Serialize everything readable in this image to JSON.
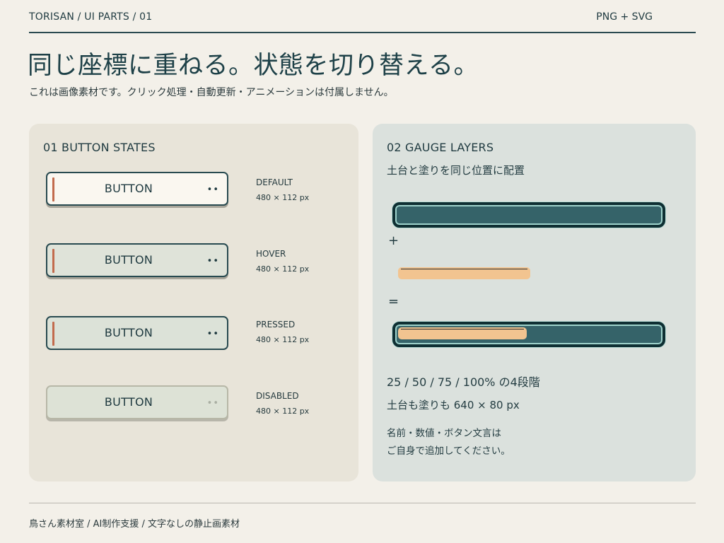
{
  "header": {
    "brand": "TORISAN / UI PARTS / 01",
    "format": "PNG + SVG"
  },
  "title": "同じ座標に重ねる。状態を切り替える。",
  "subtitle": "これは画像素材です。クリック処理・自動更新・アニメーションは付属しません。",
  "button_panel": {
    "heading": "01  BUTTON STATES",
    "buttons": [
      {
        "label": "BUTTON",
        "dots": "••",
        "state": "DEFAULT",
        "size": "480 × 112 px"
      },
      {
        "label": "BUTTON",
        "dots": "••",
        "state": "HOVER",
        "size": "480 × 112 px"
      },
      {
        "label": "BUTTON",
        "dots": "••",
        "state": "PRESSED",
        "size": "480 × 112 px"
      },
      {
        "label": "BUTTON",
        "dots": "••",
        "state": "DISABLED",
        "size": "480 × 112 px"
      }
    ]
  },
  "gauge_panel": {
    "heading": "02  GAUGE LAYERS",
    "subheading": "土台と塗りを同じ位置に配置",
    "plus": "+",
    "equals": "=",
    "fill_level": 0.5,
    "steps_note": "25 / 50 / 75 / 100% の4段階",
    "size_note": "土台も塗りも 640 × 80 px",
    "note_line1": "名前・数値・ボタン文言は",
    "note_line2": "ご自身で追加してください。"
  },
  "footer": "鳥さん素材室  /  AI制作支援  /  文字なしの静止画素材",
  "colors": {
    "background": "#f3f0e9",
    "gauge_base": "#356369",
    "gauge_fill": "#f2c490",
    "accent": "#c26b4d"
  }
}
